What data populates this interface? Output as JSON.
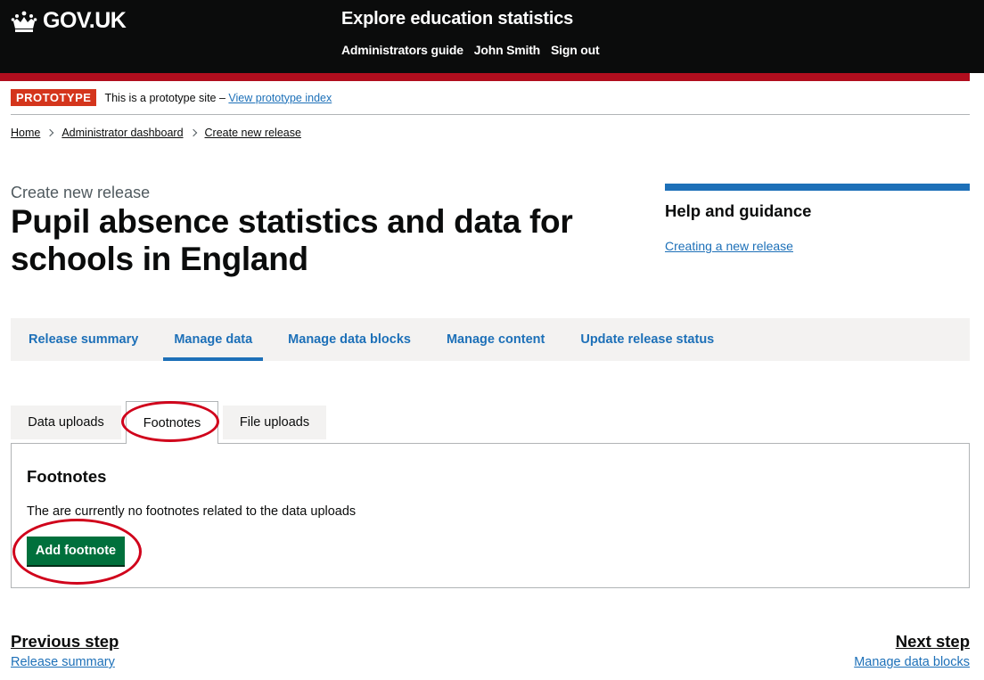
{
  "header": {
    "logo_text": "GOV.UK",
    "service_name": "Explore education statistics",
    "nav": [
      "Administrators guide",
      "John Smith",
      "Sign out"
    ]
  },
  "phase": {
    "tag": "PROTOTYPE",
    "text": "This is a prototype site – ",
    "link": "View prototype index"
  },
  "breadcrumbs": [
    "Home",
    "Administrator dashboard",
    "Create new release"
  ],
  "page": {
    "caption": "Create new release",
    "title": "Pupil absence statistics and data for schools in England"
  },
  "related": {
    "heading": "Help and guidance",
    "link": "Creating a new release"
  },
  "nav_tabs": [
    {
      "label": "Release summary",
      "active": false
    },
    {
      "label": "Manage data",
      "active": true
    },
    {
      "label": "Manage data blocks",
      "active": false
    },
    {
      "label": "Manage content",
      "active": false
    },
    {
      "label": "Update release status",
      "active": false
    }
  ],
  "sub_tabs": [
    {
      "label": "Data uploads",
      "active": false
    },
    {
      "label": "Footnotes",
      "active": true
    },
    {
      "label": "File uploads",
      "active": false
    }
  ],
  "panel": {
    "heading": "Footnotes",
    "message": "The are currently no footnotes related to the data uploads",
    "button": "Add footnote"
  },
  "pagination": {
    "prev_title": "Previous step",
    "prev_link": "Release summary",
    "next_title": "Next step",
    "next_link": "Manage data blocks"
  },
  "colors": {
    "header": "#0b0c0c",
    "header_bar": "#b10e1e",
    "link": "#1d70b8",
    "button": "#00703c",
    "annotation": "#d0021b"
  }
}
